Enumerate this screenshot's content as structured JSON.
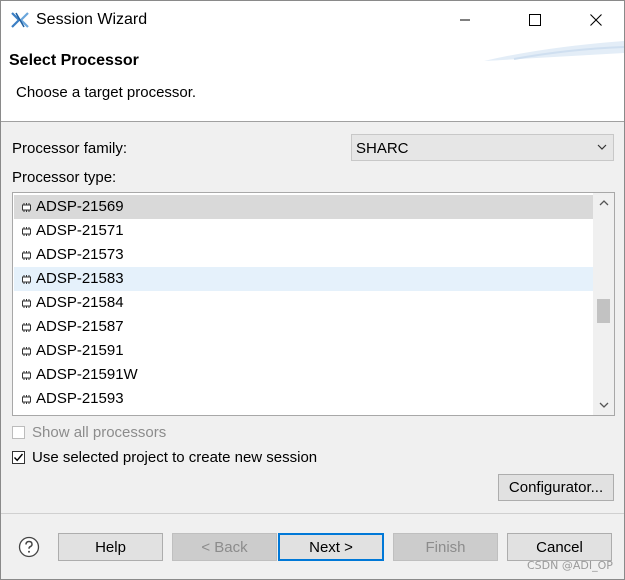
{
  "window": {
    "title": "Session Wizard"
  },
  "header": {
    "title": "Select Processor",
    "description": "Choose a target processor."
  },
  "form": {
    "family_label": "Processor family:",
    "family_value": "SHARC",
    "type_label": "Processor type:"
  },
  "processor_list": [
    {
      "name": "ADSP-21569",
      "state": "selected"
    },
    {
      "name": "ADSP-21571",
      "state": "normal"
    },
    {
      "name": "ADSP-21573",
      "state": "normal"
    },
    {
      "name": "ADSP-21583",
      "state": "hover"
    },
    {
      "name": "ADSP-21584",
      "state": "normal"
    },
    {
      "name": "ADSP-21587",
      "state": "normal"
    },
    {
      "name": "ADSP-21591",
      "state": "normal"
    },
    {
      "name": "ADSP-21591W",
      "state": "normal"
    },
    {
      "name": "ADSP-21593",
      "state": "normal"
    }
  ],
  "options": {
    "show_all_label": "Show all processors",
    "show_all_checked": false,
    "show_all_enabled": false,
    "use_selected_label": "Use selected project to create new session",
    "use_selected_checked": true
  },
  "buttons": {
    "configurator": "Configurator...",
    "help": "Help",
    "back": "< Back",
    "next": "Next >",
    "finish": "Finish",
    "cancel": "Cancel"
  },
  "watermark": "CSDN @ADI_OP",
  "colors": {
    "accent": "#0078d7",
    "selected_row": "#d9d9d9",
    "hover_row": "#e5f1fb"
  }
}
